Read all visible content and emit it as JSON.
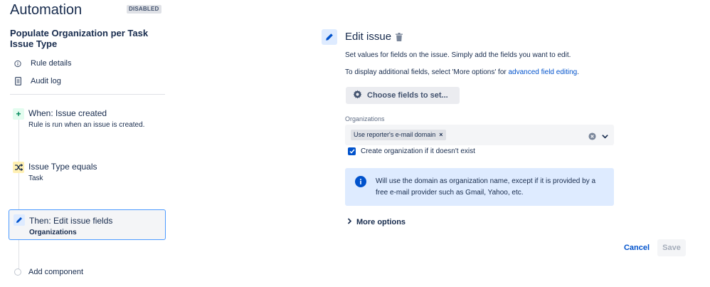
{
  "app": {
    "title": "Automation",
    "status_badge": "DISABLED"
  },
  "rule": {
    "name": "Populate Organization per Task Issue Type",
    "links": [
      {
        "label": "Rule details",
        "icon": "info-icon"
      },
      {
        "label": "Audit log",
        "icon": "clipboard-icon"
      }
    ]
  },
  "components": [
    {
      "title": "When: Issue created",
      "subtitle": "Rule is run when an issue is created.",
      "icon": "plus-icon"
    },
    {
      "title": "Issue Type equals",
      "subtitle": "Task",
      "icon": "shuffle-icon"
    },
    {
      "title": "Then: Edit issue fields",
      "subtitle": "Organizations",
      "icon": "pencil-icon",
      "selected": true
    }
  ],
  "add_component": "Add component",
  "panel": {
    "title": "Edit issue",
    "description": "Set values for fields on the issue. Simply add the fields you want to edit.",
    "additional_prefix": "To display additional fields, select 'More options' for ",
    "additional_link": "advanced field editing",
    "additional_suffix": ".",
    "choose_fields_label": "Choose fields to set...",
    "organizations": {
      "label": "Organizations",
      "tag": "Use reporter's e-mail domain"
    },
    "create_org_checkbox": {
      "label": "Create organization if it doesn't exist",
      "checked": true
    },
    "info": "Will use the domain as organization name, except if it is provided by a free e-mail provider such as Gmail, Yahoo, etc.",
    "more_options": "More options",
    "cancel": "Cancel",
    "save": "Save"
  },
  "colors": {
    "primary": "#0052cc",
    "info_bg": "#deebff",
    "trigger_bg": "#e3fcef",
    "condition_bg": "#fff0b3",
    "selected_border": "#4c9aff"
  }
}
